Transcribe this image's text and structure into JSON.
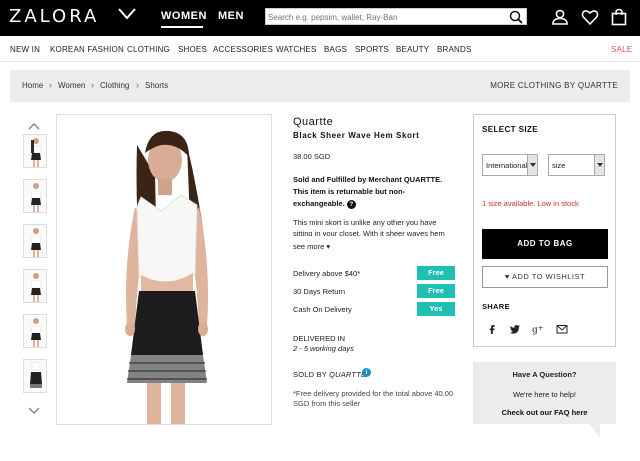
{
  "header": {
    "logo": "ZALORA",
    "nav_women": "WOMEN",
    "nav_men": "MEN",
    "search_placeholder": "Search e.g. pepsim, wallet, Ray-Ban",
    "icons": [
      "account-icon",
      "wishlist-heart-icon",
      "shopping-bag-icon"
    ]
  },
  "categories": {
    "items": [
      "NEW IN",
      "KOREAN FASHION",
      "CLOTHING",
      "SHOES",
      "ACCESSORIES",
      "WATCHES",
      "BAGS",
      "SPORTS",
      "BEAUTY",
      "BRANDS"
    ],
    "sale": "SALE",
    "sale_color": "#d9534f"
  },
  "breadcrumb": {
    "items": [
      "Home",
      "Women",
      "Clothing",
      "Shorts"
    ],
    "sep": "›",
    "more_link": "MORE CLOTHING BY QUARTTE"
  },
  "product": {
    "brand": "Quartte",
    "name": "Black Sheer Wave Hem Skort",
    "price": "38.00 SGD",
    "seller_line1": "Sold and Fulfilled by Merchant QUARTTE.",
    "seller_line2": "This item is returnable but non-exchangeable.",
    "description": "This mini skort is unlike any other you have sitting in your closet. With it sheer waves hem",
    "see_more": "see more ▾",
    "perks": [
      {
        "label": "Delivery above $40*",
        "badge": "Free"
      },
      {
        "label": "30 Days Return",
        "badge": "Free"
      },
      {
        "label": "Cash On Delivery",
        "badge": "Yes"
      }
    ],
    "perk_color": "#1fbfb3",
    "delivered_label": "DELIVERED IN",
    "delivered_value": "2 - 5 working days",
    "sold_by_label": "SOLD BY",
    "sold_by_value": "QUARTTE",
    "free_delivery_note": "*Free delivery provided for the total above 40.00 SGD from this seller"
  },
  "size_panel": {
    "title": "SELECT SIZE",
    "size_system": "International",
    "size_placeholder": "size",
    "availability": "1 size available. Low in stock",
    "add_to_bag": "ADD TO BAG",
    "add_to_wishlist": "♥ ADD TO WISHLIST",
    "share_title": "SHARE",
    "share_icons": [
      "facebook-icon",
      "twitter-icon",
      "google-plus-icon",
      "email-icon"
    ]
  },
  "question_box": {
    "title": "Have A Question?",
    "subtitle": "We're here to help!",
    "faq_link": "Check out our FAQ here"
  }
}
